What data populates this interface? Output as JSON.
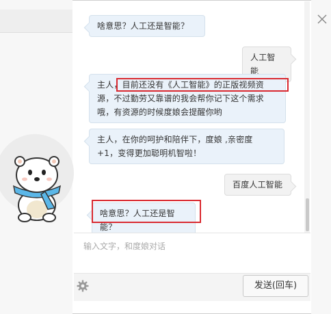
{
  "window": {
    "close_icon": "close-icon"
  },
  "colors": {
    "bot_bubble": "#eaf2fa",
    "user_bubble": "#f2f2f2",
    "highlight": "#d9282f"
  },
  "messages": [
    {
      "role": "bot",
      "lines": [
        "啥意思？人工还是智能？"
      ]
    },
    {
      "role": "user",
      "lines": [
        "人工智能"
      ]
    },
    {
      "role": "bot",
      "lines": [
        "主人，目前还没有《人工智能》的正版视频资",
        "源，不过勤劳又靠谱的我会帮你记下这个需求",
        "哦，有资源的时候度娘会提醒你哟"
      ]
    },
    {
      "role": "bot",
      "lines": [
        "主人，在你的呵护和陪伴下，度娘 ,亲密度",
        "+1，变得更加聪明机智啦！"
      ]
    },
    {
      "role": "user",
      "lines": [
        "百度人工智能"
      ]
    },
    {
      "role": "bot",
      "lines": [
        "啥意思？人工还是智能？"
      ]
    }
  ],
  "input": {
    "placeholder": "输入文字，和度娘对话"
  },
  "footer": {
    "send_label": "发送(回车)",
    "settings_icon": "gear-icon"
  },
  "avatar": {
    "icon": "polar-bear-mascot"
  }
}
